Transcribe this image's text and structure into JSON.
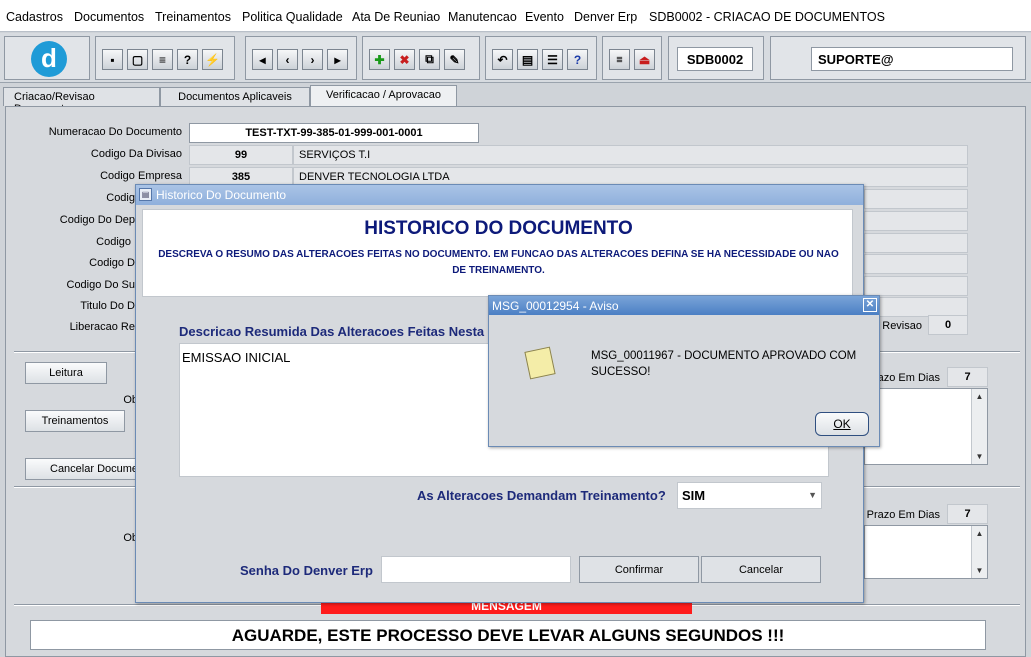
{
  "menu": [
    "Cadastros",
    "Documentos",
    "Treinamentos",
    "Politica Qualidade",
    "Ata De Reuniao",
    "Manutencao",
    "Evento",
    "Denver Erp",
    "SDB0002 - CRIACAO DE DOCUMENTOS"
  ],
  "toolbar": {
    "screen_code": "SDB0002",
    "user": "SUPORTE@"
  },
  "tabs": [
    "Criacao/Revisao Documento",
    "Documentos Aplicaveis",
    "Verificacao / Aprovacao"
  ],
  "form": {
    "numeracao_label": "Numeracao Do Documento",
    "numeracao": "TEST-TXT-99-385-01-999-001-0001",
    "divisao_label": "Codigo Da Divisao",
    "divisao_cod": "99",
    "divisao_nome": "SERVIÇOS T.I",
    "empresa_label": "Codigo Empresa",
    "empresa_cod": "385",
    "empresa_nome": "DENVER TECNOLOGIA LTDA",
    "row3_label": "Codig",
    "row4_label": "Codigo Do Dep",
    "row5_label": "Codigo",
    "row6_label": "Codigo D",
    "row7_label": "Codigo Do Su",
    "row8_label": "Titulo Do D",
    "row9_label": "Liberacao Re",
    "revisao_label": "Revisao",
    "revisao": "0"
  },
  "buttons": {
    "leitura": "Leitura",
    "treinamentos": "Treinamentos",
    "cancelar_documento": "Cancelar Docume"
  },
  "section": {
    "obs1_label": "Ob",
    "prazo1_label": "Prazo Em Dias",
    "prazo1": "7",
    "obs2_label": "Ob",
    "prazo2_label": "Prazo Em Dias",
    "prazo2": "7"
  },
  "historico": {
    "window_title": "Historico Do Documento",
    "heading": "HISTORICO DO DOCUMENTO",
    "description": "DESCREVA O RESUMO DAS ALTERACOES FEITAS NO DOCUMENTO. EM FUNCAO DAS ALTERACOES DEFINA SE HA NECESSIDADE OU NAO DE TREINAMENTO.",
    "descricao_label": "Descricao Resumida Das Alteracoes Feitas Nesta",
    "descricao_text": "EMISSAO INICIAL",
    "treinamento_label": "As Alteracoes Demandam Treinamento?",
    "treinamento_value": "SIM",
    "senha_label": "Senha Do Denver Erp",
    "senha_value": "",
    "confirmar": "Confirmar",
    "cancelar": "Cancelar"
  },
  "message_box": {
    "title": "MSG_00012954 - Aviso",
    "text": "MSG_00011967 - DOCUMENTO APROVADO COM SUCESSO!",
    "ok": "OK"
  },
  "mensagem_bar": "MENSAGEM",
  "status": "AGUARDE, ESTE PROCESSO DEVE LEVAR ALGUNS SEGUNDOS !!!"
}
